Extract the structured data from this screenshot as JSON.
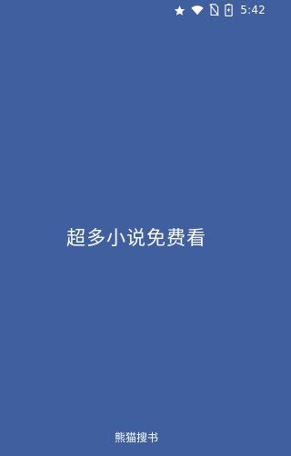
{
  "status_bar": {
    "icons": [
      "star-icon",
      "wifi-icon",
      "no-sim-icon",
      "battery-charging-icon"
    ],
    "time": "5:42"
  },
  "splash": {
    "tagline": "超多小说免费看",
    "app_name": "熊猫搜书"
  },
  "colors": {
    "background": "#3f5f9e",
    "foreground": "#ffffff"
  }
}
